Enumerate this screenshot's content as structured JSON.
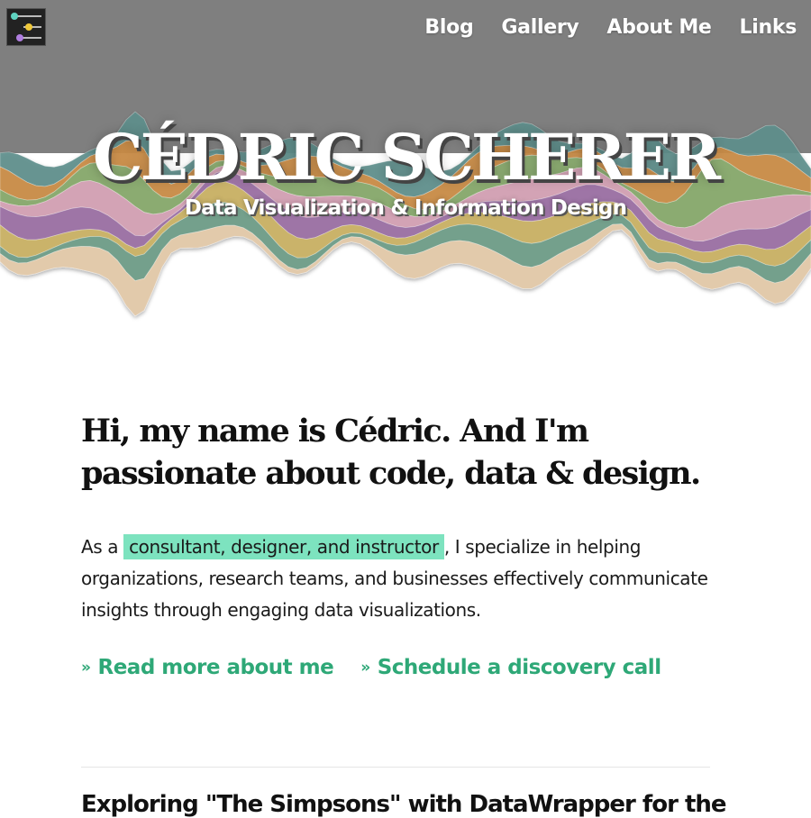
{
  "colors": {
    "header_gray": "#7f7f7f",
    "accent_green": "#2ea877",
    "highlight_green": "#7de3bf",
    "stream_colors": [
      "#5f8f8c",
      "#c98b45",
      "#86a86a",
      "#d29fb2",
      "#9a6fa3",
      "#c9b163",
      "#6e9c87",
      "#e3c9a8"
    ]
  },
  "logo": {
    "icon": "timeline-logo-icon"
  },
  "nav": {
    "items": [
      {
        "label": "Blog"
      },
      {
        "label": "Gallery"
      },
      {
        "label": "About Me"
      },
      {
        "label": "Links"
      }
    ]
  },
  "hero": {
    "title": "CÉDRIC SCHERER",
    "subtitle": "Data Visualization & Information Design"
  },
  "intro": {
    "heading": "Hi, my name is Cédric. And I'm passionate about code, data & design.",
    "text_before": "As a ",
    "highlight": "consultant, designer, and instructor",
    "text_after": ", I specialize in helping organizations, research teams, and businesses effectively communicate insights through engaging data visualizations."
  },
  "links": [
    {
      "icon": "double-chevron-right-icon",
      "label": "Read more about me"
    },
    {
      "icon": "double-chevron-right-icon",
      "label": "Schedule a discovery call"
    }
  ],
  "posts": [
    {
      "title": "Exploring \"The Simpsons\" with DataWrapper for the"
    }
  ]
}
